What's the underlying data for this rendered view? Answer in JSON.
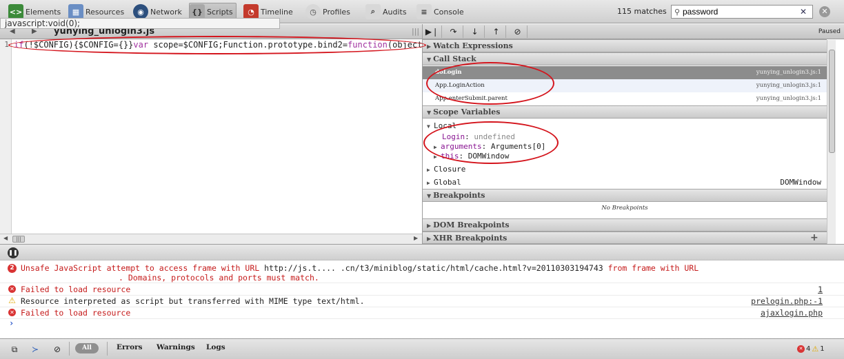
{
  "toolbar": {
    "tabs": [
      {
        "label": "Elements",
        "icon": "elements-icon"
      },
      {
        "label": "Resources",
        "icon": "resources-icon"
      },
      {
        "label": "Network",
        "icon": "network-icon"
      },
      {
        "label": "Scripts",
        "icon": "scripts-icon",
        "active": true
      },
      {
        "label": "Timeline",
        "icon": "timeline-icon"
      },
      {
        "label": "Profiles",
        "icon": "profiles-icon"
      },
      {
        "label": "Audits",
        "icon": "audits-icon"
      },
      {
        "label": "Console",
        "icon": "console-icon"
      }
    ],
    "match_count": "115 matches",
    "search_value": "password"
  },
  "tooltip": "javascript:void(0);",
  "source": {
    "file_name": "yunying_unlogin3.js",
    "line_number": "1",
    "code_parts": [
      "if",
      "(!$CONFIG){$CONFIG={}}",
      "var",
      " scope=$CONFIG;Function.prototype.bind2=",
      "function",
      "(object){"
    ]
  },
  "sidebar": {
    "paused": "Paused",
    "watch_expressions": "Watch Expressions",
    "call_stack": {
      "title": "Call Stack",
      "frames": [
        {
          "name": "doLogin",
          "location": "yunying_unlogin3.js:1"
        },
        {
          "name": "App.LoginAction",
          "location": "yunying_unlogin3.js:1"
        },
        {
          "name": "App.enterSubmit.parent",
          "location": "yunying_unlogin3.js:1"
        }
      ]
    },
    "scope_variables": {
      "title": "Scope Variables",
      "local": "Local",
      "login_name": "Login",
      "login_value": "undefined",
      "arguments_name": "arguments",
      "arguments_value": "Arguments[0]",
      "this_name": "this",
      "this_value": "DOMWindow",
      "closure": "Closure",
      "global": "Global",
      "global_value": "DOMWindow"
    },
    "breakpoints": "Breakpoints",
    "no_breakpoints": "No Breakpoints",
    "dom_breakpoints": "DOM Breakpoints",
    "xhr_breakpoints": "XHR Breakpoints"
  },
  "console": {
    "messages": [
      {
        "count": "2",
        "text": "Unsafe JavaScript attempt to access frame with URL ",
        "url": "http://js.t.... .cn/t3/miniblog/static/html/cache.html?v=20110303194743",
        "text2": " from frame with URL",
        "text3": ". Domains, protocols and ports must match."
      },
      {
        "text": "Failed to load resource",
        "link": "1"
      },
      {
        "text": "Resource interpreted as script but transferred with MIME type text/html.",
        "link": "prelogin.php:-1"
      },
      {
        "text": "Failed to load resource",
        "link": "ajaxlogin.php"
      }
    ],
    "prompt": "›"
  },
  "statusbar": {
    "filter_all": "All",
    "filter_errors": "Errors",
    "filter_warnings": "Warnings",
    "filter_logs": "Logs",
    "error_count": "4",
    "warning_count": "1"
  },
  "colors": {
    "annotation": "#d4141c",
    "error": "#c51a1a",
    "keyword": "#a0319f"
  }
}
